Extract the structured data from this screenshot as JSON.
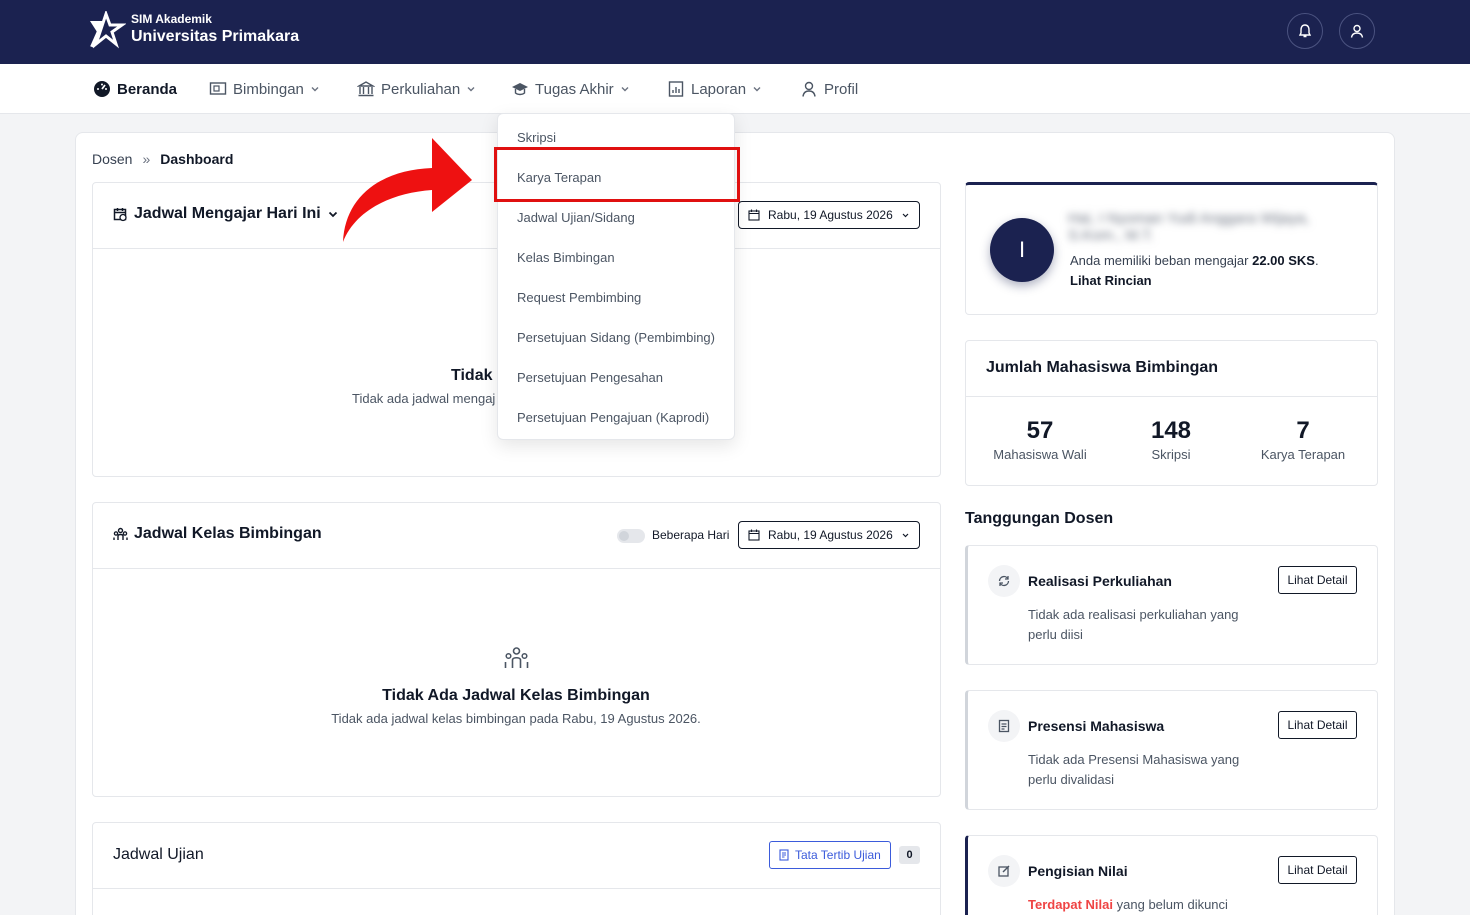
{
  "header": {
    "brand_small": "SIM Akademik",
    "brand_big": "Universitas Primakara",
    "icons": [
      "bell-icon",
      "user-icon"
    ]
  },
  "nav": {
    "items": [
      {
        "label": "Beranda",
        "icon": "dashboard-icon",
        "active": true
      },
      {
        "label": "Bimbingan",
        "icon": "presentation-icon"
      },
      {
        "label": "Perkuliahan",
        "icon": "building-icon"
      },
      {
        "label": "Tugas Akhir",
        "icon": "graduation-cap-icon"
      },
      {
        "label": "Laporan",
        "icon": "report-icon"
      },
      {
        "label": "Profil",
        "icon": "user-icon"
      }
    ]
  },
  "dropdown": {
    "items": [
      "Skripsi",
      "Karya Terapan",
      "Jadwal Ujian/Sidang",
      "Kelas Bimbingan",
      "Request Pembimbing",
      "Persetujuan Sidang (Pembimbing)",
      "Persetujuan Pengesahan",
      "Persetujuan Pengajuan (Kaprodi)"
    ],
    "highlighted": "Karya Terapan"
  },
  "breadcrumb": {
    "parent": "Dosen",
    "sep": "»",
    "current": "Dashboard"
  },
  "jadwal_mengajar": {
    "title": "Jadwal Mengajar Hari Ini",
    "date": "Rabu, 19 Agustus 2026",
    "empty_title": "Tidak",
    "empty_sub": "Tidak ada jadwal mengaj"
  },
  "jadwal_bimbingan": {
    "title": "Jadwal Kelas Bimbingan",
    "toggle_label": "Beberapa Hari",
    "date": "Rabu, 19 Agustus 2026",
    "empty_title": "Tidak Ada Jadwal Kelas Bimbingan",
    "empty_sub": "Tidak ada jadwal kelas bimbingan pada Rabu, 19 Agustus 2026."
  },
  "jadwal_ujian": {
    "title": "Jadwal Ujian",
    "button": "Tata Tertib Ujian",
    "count": "0"
  },
  "profile": {
    "initial": "I",
    "name_line1": "Hai, I Nyoman Yudi Anggara Wijaya,",
    "name_line2": "S.Kom., M.T.",
    "load_text": "Anda memiliki beban mengajar",
    "load_value": "22.00 SKS",
    "load_end": ".",
    "link": "Lihat Rincian"
  },
  "bimbingan_stats": {
    "title": "Jumlah Mahasiswa Bimbingan",
    "stats": [
      {
        "value": "57",
        "label": "Mahasiswa Wali"
      },
      {
        "value": "148",
        "label": "Skripsi"
      },
      {
        "value": "7",
        "label": "Karya Terapan"
      }
    ]
  },
  "tanggungan": {
    "title": "Tanggungan Dosen",
    "items": [
      {
        "title": "Realisasi Perkuliahan",
        "desc": "Tidak ada realisasi perkuliahan yang perlu diisi",
        "button": "Lihat Detail",
        "icon": "refresh-icon"
      },
      {
        "title": "Presensi Mahasiswa",
        "desc": "Tidak ada Presensi Mahasiswa yang perlu divalidasi",
        "button": "Lihat Detail",
        "icon": "document-icon"
      },
      {
        "title": "Pengisian Nilai",
        "desc_highlight": "Terdapat Nilai",
        "desc": "yang belum dikunci",
        "button": "Lihat Detail",
        "icon": "edit-icon"
      }
    ]
  },
  "colors": {
    "navy": "#1b2250",
    "highlight_red": "#e01010",
    "accent_red": "#ef4444",
    "link_blue": "#3b5bdb"
  }
}
